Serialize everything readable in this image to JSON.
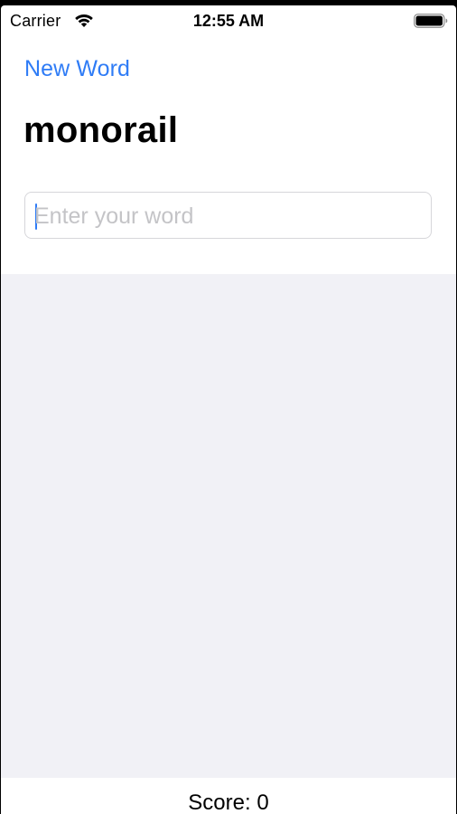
{
  "status_bar": {
    "carrier": "Carrier",
    "time": "12:55 AM",
    "wifi_icon": "wifi-icon",
    "battery_icon": "battery-icon"
  },
  "nav": {
    "new_word_label": "New Word"
  },
  "root_word": "monorail",
  "word_input": {
    "value": "",
    "placeholder": "Enter your word"
  },
  "used_words": [],
  "footer": {
    "score_text": "Score: 0"
  },
  "colors": {
    "accent": "#2f7cf6",
    "list_background": "#f1f1f6",
    "placeholder": "#c4c4c7"
  }
}
